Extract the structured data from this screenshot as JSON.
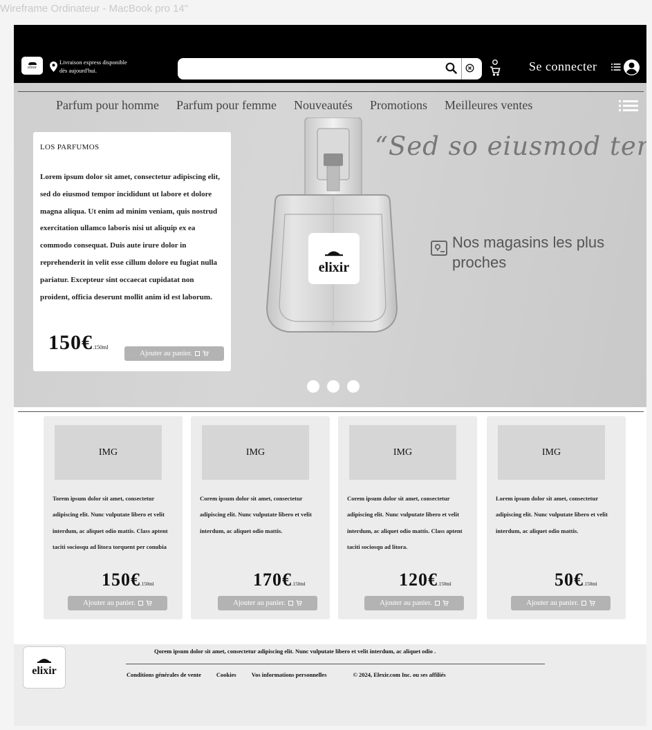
{
  "frame_label": "Wireframe Ordinateur - MacBook pro 14\"",
  "brand": {
    "name": "elixir"
  },
  "header": {
    "delivery_line1": "Livraison express disponible",
    "delivery_line2": "dès aujourd'hui.",
    "search_placeholder": "",
    "signin_label": "Se connecter"
  },
  "nav": {
    "items": [
      "Parfum pour homme",
      "Parfum pour femme",
      "Nouveautés",
      "Promotions",
      "Meilleures ventes"
    ]
  },
  "hero": {
    "category": "LOS PARFUMOS",
    "description": "Lorem ipsum dolor sit amet, consectetur adipiscing elit, sed do eiusmod tempor incididunt ut labore et dolore magna aliqua. Ut enim ad minim veniam, quis nostrud exercitation ullamco laboris nisi ut aliquip ex ea commodo consequat. Duis aute irure dolor in reprehenderit in velit esse cillum dolore eu fugiat nulla pariatur. Excepteur sint occaecat cupidatat non proident, officia deserunt mollit anim id est laborum.",
    "price": "150€",
    "unit": ".150ml",
    "cart_label": "Ajouter au panier.",
    "quote": "“Sed so eiusmod tempor”",
    "stores_label": "Nos magasins les plus proches",
    "carousel_dots": 3
  },
  "products": [
    {
      "img_label": "IMG",
      "text": "Torem ipsum dolor sit amet, consectetur adipiscing elit. Nunc vulputate libero et velit interdum, ac aliquet odio mattis. Class aptent taciti sociosqu ad litora torquent per conubia",
      "price": "150€",
      "unit": ".150ml",
      "cart_label": "Ajouter au panier."
    },
    {
      "img_label": "IMG",
      "text": "Corem ipsum dolor sit amet, consectetur adipiscing elit. Nunc vulputate libero et velit interdum, ac aliquet odio mattis.",
      "price": "170€",
      "unit": ".150ml",
      "cart_label": "Ajouter au panier."
    },
    {
      "img_label": "IMG",
      "text": "Corem ipsum dolor sit amet, consectetur adipiscing elit. Nunc vulputate libero et velit interdum, ac aliquet odio mattis. Class aptent taciti sociosqu ad litora.",
      "price": "120€",
      "unit": ".150ml",
      "cart_label": "Ajouter au panier."
    },
    {
      "img_label": "IMG",
      "text": "Lorem ipsum dolor sit amet, consectetur adipiscing elit. Nunc vulputate libero et velit interdum, ac aliquet odio mattis.",
      "price": "50€",
      "unit": ".150ml",
      "cart_label": "Ajouter au panier."
    }
  ],
  "footer": {
    "description": "Qorem ipsum dolor sit amet, consectetur adipiscing elit. Nunc vulputate libero et velit interdum, ac aliquet odio .",
    "links": [
      "Conditions générales de vente",
      "Cookies",
      "Vos informations personnelles"
    ],
    "copyright": "© 2024, Elexir.com Inc. ou ses affiliés"
  },
  "colors": {
    "topbar": "#000000",
    "button": "#b3b3b3",
    "card_bg": "#ececec",
    "img_placeholder": "#d6d6d6"
  }
}
